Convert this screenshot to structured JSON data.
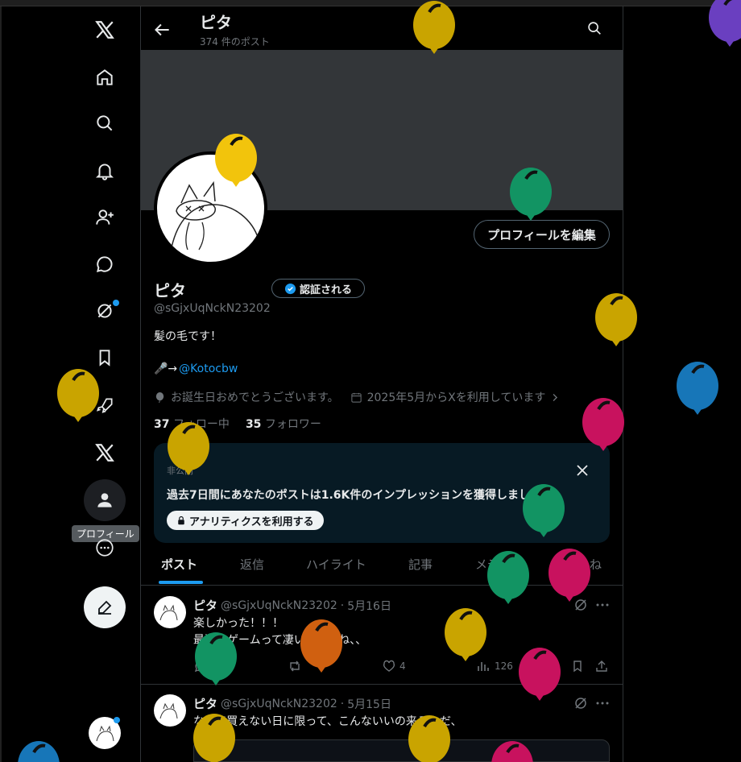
{
  "header": {
    "name": "ピタ",
    "post_count": "374 件のポスト"
  },
  "nav": {
    "tooltip": "プロフィール"
  },
  "profile": {
    "name": "ピタ",
    "verify_label": "認証される",
    "handle": "@sGjxUqNckN23202",
    "bio_line1": "髪の毛です！",
    "bio_line2_prefix": "🎤→",
    "bio_line2_link": "@Kotocbw",
    "birthday": "お誕生日おめでとうございます。",
    "joined": "2025年5月からXを利用しています",
    "following_count": "37",
    "following_label": "フォロー中",
    "followers_count": "35",
    "followers_label": "フォロワー",
    "edit_button": "プロフィールを編集"
  },
  "analytics_card": {
    "tag": "非公開",
    "text": "過去7日間にあなたのポストは1.6K件のインプレッションを獲得しました",
    "button": "アナリティクスを利用する"
  },
  "tabs": [
    "ポスト",
    "返信",
    "ハイライト",
    "記事",
    "メディア",
    "いいね"
  ],
  "tweets": [
    {
      "name": "ピタ",
      "handle": "@sGjxUqNckN23202",
      "date": "5月16日",
      "line1": "楽しかった！！！",
      "line2": "最近のゲームって凄いんですね、、",
      "likes": "4",
      "views": "126"
    },
    {
      "name": "ピタ",
      "handle": "@sGjxUqNckN23202",
      "date": "5月15日",
      "line1": "なんで買えない日に限って、こんないいの来るんだ、"
    }
  ],
  "colors": {
    "accent": "#1d9bf0",
    "balloon_gold": "#c9a400",
    "balloon_green": "#129463",
    "balloon_pink": "#c8125e",
    "balloon_blue": "#1776b8",
    "balloon_purple": "#6a3fc0",
    "balloon_orange": "#d06010",
    "balloon_yellow": "#f2c40c"
  }
}
